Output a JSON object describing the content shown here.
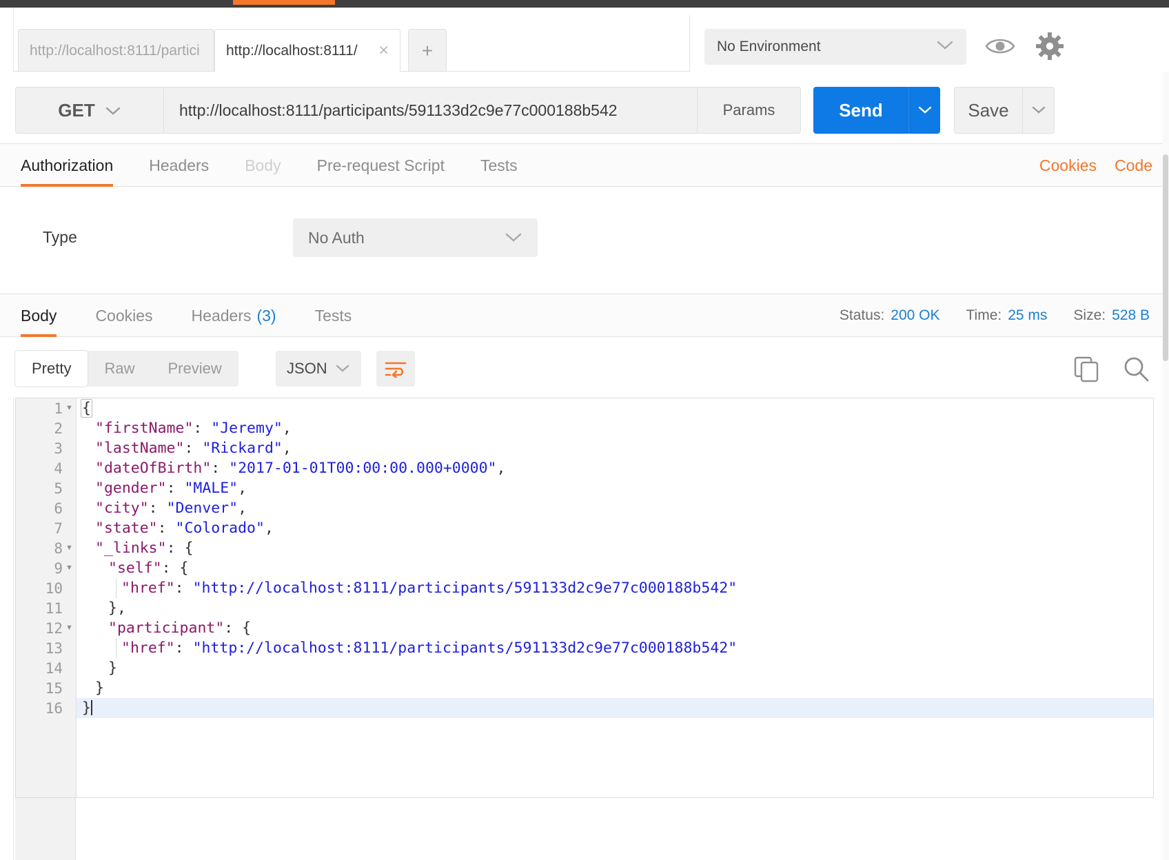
{
  "window": {
    "accent_color": "#f3762b",
    "primary_blue": "#0d7ae5"
  },
  "tabbar": {
    "tabs": [
      {
        "label": "http://localhost:8111/partici",
        "active": false
      },
      {
        "label": "http://localhost:8111/",
        "active": true
      }
    ],
    "close_glyph": "×",
    "add_glyph": "+",
    "environment": {
      "selected": "No Environment",
      "caret": "⌄"
    }
  },
  "request": {
    "method": "GET",
    "url": "http://localhost:8111/participants/591133d2c9e77c000188b542",
    "params_label": "Params",
    "send_label": "Send",
    "save_label": "Save",
    "tabs": [
      {
        "label": "Authorization",
        "state": "active"
      },
      {
        "label": "Headers",
        "state": "normal"
      },
      {
        "label": "Body",
        "state": "disabled"
      },
      {
        "label": "Pre-request Script",
        "state": "normal"
      },
      {
        "label": "Tests",
        "state": "normal"
      }
    ],
    "cookies_link": "Cookies",
    "code_link": "Code"
  },
  "authorization": {
    "type_label": "Type",
    "type_value": "No Auth"
  },
  "response": {
    "tabs": [
      {
        "label": "Body",
        "badge": "",
        "active": true
      },
      {
        "label": "Cookies",
        "badge": "",
        "active": false
      },
      {
        "label": "Headers",
        "badge": "(3)",
        "active": false
      },
      {
        "label": "Tests",
        "badge": "",
        "active": false
      }
    ],
    "status_label": "Status:",
    "status_value": "200 OK",
    "time_label": "Time:",
    "time_value": "25 ms",
    "size_label": "Size:",
    "size_value": "528 B"
  },
  "body_toolbar": {
    "views": [
      {
        "label": "Pretty",
        "active": true
      },
      {
        "label": "Raw",
        "active": false
      },
      {
        "label": "Preview",
        "active": false
      }
    ],
    "format": "JSON",
    "wrap_icon": "word-wrap-icon",
    "copy_icon": "copy-icon",
    "search_icon": "search-icon"
  },
  "response_body": {
    "language": "json",
    "lines": [
      {
        "n": 1,
        "fold": true,
        "indent": 0,
        "tokens": [
          {
            "t": "p",
            "v": "{"
          }
        ],
        "boxed_brace": true
      },
      {
        "n": 2,
        "fold": false,
        "indent": 1,
        "tokens": [
          {
            "t": "k",
            "v": "\"firstName\""
          },
          {
            "t": "p",
            "v": ": "
          },
          {
            "t": "s",
            "v": "\"Jeremy\""
          },
          {
            "t": "p",
            "v": ","
          }
        ]
      },
      {
        "n": 3,
        "fold": false,
        "indent": 1,
        "tokens": [
          {
            "t": "k",
            "v": "\"lastName\""
          },
          {
            "t": "p",
            "v": ": "
          },
          {
            "t": "s",
            "v": "\"Rickard\""
          },
          {
            "t": "p",
            "v": ","
          }
        ]
      },
      {
        "n": 4,
        "fold": false,
        "indent": 1,
        "tokens": [
          {
            "t": "k",
            "v": "\"dateOfBirth\""
          },
          {
            "t": "p",
            "v": ": "
          },
          {
            "t": "s",
            "v": "\"2017-01-01T00:00:00.000+0000\""
          },
          {
            "t": "p",
            "v": ","
          }
        ]
      },
      {
        "n": 5,
        "fold": false,
        "indent": 1,
        "tokens": [
          {
            "t": "k",
            "v": "\"gender\""
          },
          {
            "t": "p",
            "v": ": "
          },
          {
            "t": "s",
            "v": "\"MALE\""
          },
          {
            "t": "p",
            "v": ","
          }
        ]
      },
      {
        "n": 6,
        "fold": false,
        "indent": 1,
        "tokens": [
          {
            "t": "k",
            "v": "\"city\""
          },
          {
            "t": "p",
            "v": ": "
          },
          {
            "t": "s",
            "v": "\"Denver\""
          },
          {
            "t": "p",
            "v": ","
          }
        ]
      },
      {
        "n": 7,
        "fold": false,
        "indent": 1,
        "tokens": [
          {
            "t": "k",
            "v": "\"state\""
          },
          {
            "t": "p",
            "v": ": "
          },
          {
            "t": "s",
            "v": "\"Colorado\""
          },
          {
            "t": "p",
            "v": ","
          }
        ]
      },
      {
        "n": 8,
        "fold": true,
        "indent": 1,
        "tokens": [
          {
            "t": "k",
            "v": "\"_links\""
          },
          {
            "t": "p",
            "v": ": {"
          }
        ]
      },
      {
        "n": 9,
        "fold": true,
        "indent": 2,
        "tokens": [
          {
            "t": "k",
            "v": "\"self\""
          },
          {
            "t": "p",
            "v": ": {"
          }
        ]
      },
      {
        "n": 10,
        "fold": false,
        "indent": 3,
        "tokens": [
          {
            "t": "k",
            "v": "\"href\""
          },
          {
            "t": "p",
            "v": ": "
          },
          {
            "t": "s",
            "v": "\"http://localhost:8111/participants/591133d2c9e77c000188b542\""
          }
        ]
      },
      {
        "n": 11,
        "fold": false,
        "indent": 2,
        "tokens": [
          {
            "t": "p",
            "v": "},"
          }
        ]
      },
      {
        "n": 12,
        "fold": true,
        "indent": 2,
        "tokens": [
          {
            "t": "k",
            "v": "\"participant\""
          },
          {
            "t": "p",
            "v": ": {"
          }
        ]
      },
      {
        "n": 13,
        "fold": false,
        "indent": 3,
        "tokens": [
          {
            "t": "k",
            "v": "\"href\""
          },
          {
            "t": "p",
            "v": ": "
          },
          {
            "t": "s",
            "v": "\"http://localhost:8111/participants/591133d2c9e77c000188b542\""
          }
        ]
      },
      {
        "n": 14,
        "fold": false,
        "indent": 2,
        "tokens": [
          {
            "t": "p",
            "v": "}"
          }
        ]
      },
      {
        "n": 15,
        "fold": false,
        "indent": 1,
        "tokens": [
          {
            "t": "p",
            "v": "}"
          }
        ]
      },
      {
        "n": 16,
        "fold": false,
        "indent": 0,
        "tokens": [
          {
            "t": "p",
            "v": "}"
          }
        ],
        "highlight": true,
        "cursor": true
      }
    ]
  }
}
